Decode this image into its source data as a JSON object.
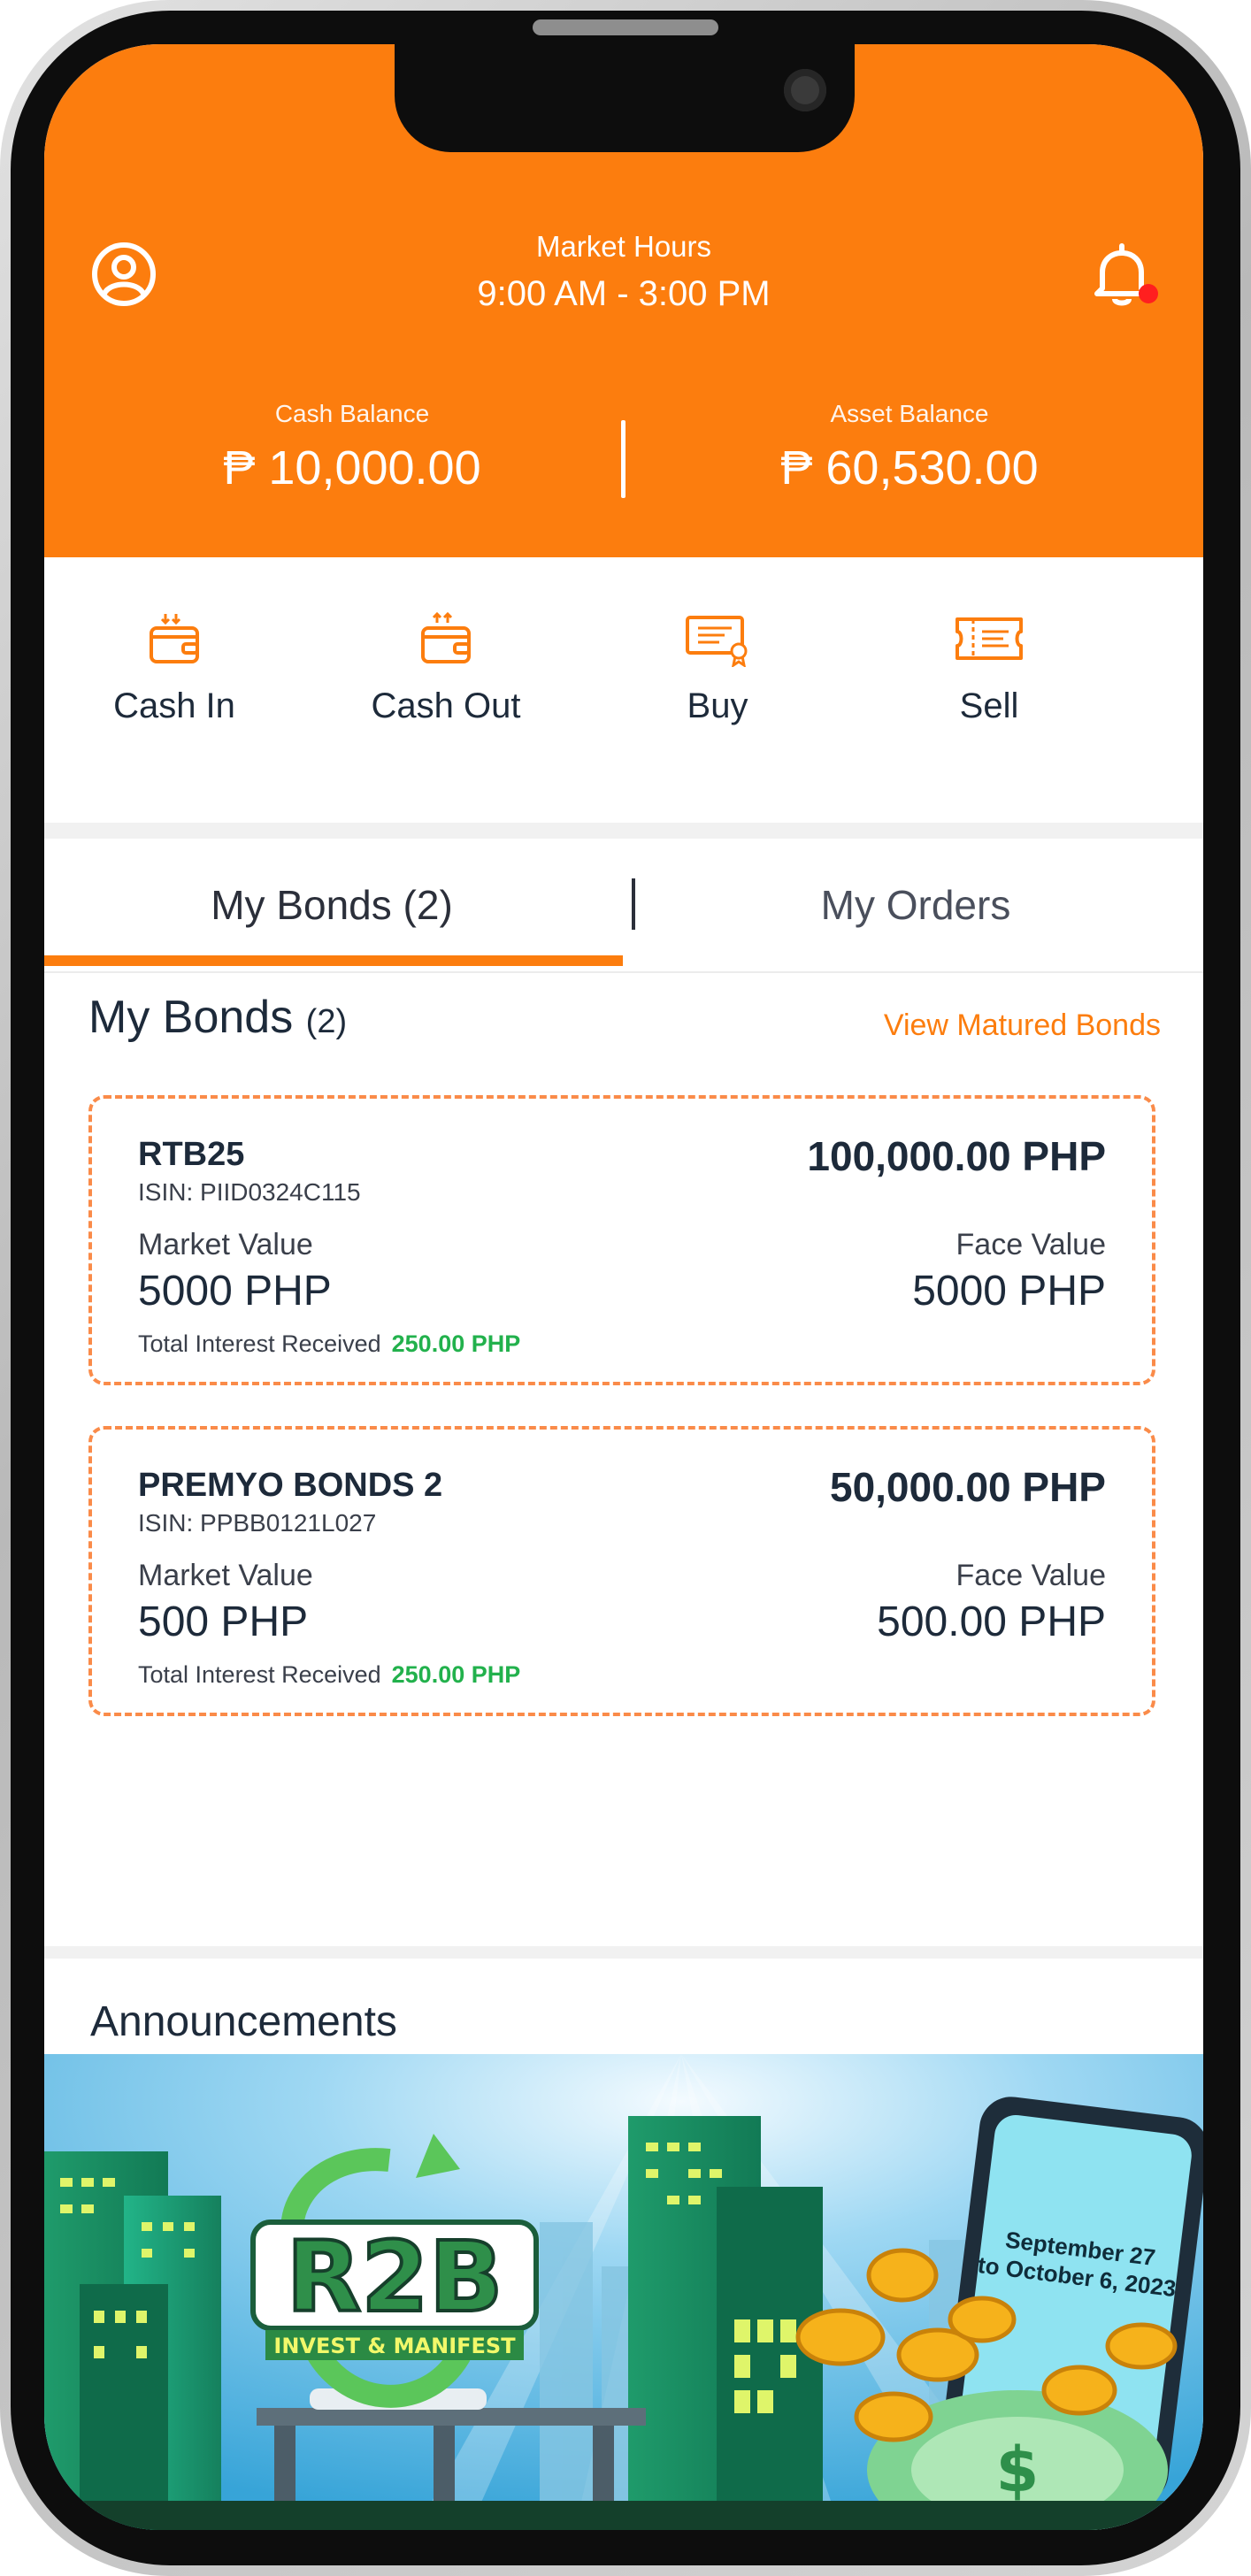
{
  "header": {
    "market_label": "Market Hours",
    "market_hours": "9:00 AM - 3:00 PM",
    "cash_label": "Cash Balance",
    "cash_value": "₱ 10,000.00",
    "asset_label": "Asset Balance",
    "asset_value": "₱ 60,530.00",
    "accent_color": "#fc7d0e",
    "notification_dot_color": "#ff1f1f"
  },
  "actions": [
    {
      "label": "Cash In",
      "icon": "wallet-in-icon"
    },
    {
      "label": "Cash Out",
      "icon": "wallet-out-icon"
    },
    {
      "label": "Buy",
      "icon": "certificate-icon"
    },
    {
      "label": "Sell",
      "icon": "ticket-icon"
    }
  ],
  "tabs": {
    "bonds": "My Bonds (2)",
    "orders": "My Orders",
    "active": "bonds"
  },
  "bonds_section": {
    "title": "My Bonds",
    "count": "(2)",
    "matured_link": "View Matured Bonds"
  },
  "bonds": [
    {
      "name": "RTB25",
      "isin": "ISIN: PIID0324C115",
      "amount": "100,000.00 PHP",
      "market_value_label": "Market Value",
      "market_value": "5000 PHP",
      "face_value_label": "Face Value",
      "face_value": "5000 PHP",
      "interest_label": "Total Interest Received",
      "interest_value": "250.00 PHP"
    },
    {
      "name": "PREMYO BONDS 2",
      "isin": "ISIN: PPBB0121L027",
      "amount": "50,000.00 PHP",
      "market_value_label": "Market Value",
      "market_value": "500 PHP",
      "face_value_label": "Face Value",
      "face_value": "500.00 PHP",
      "interest_label": "Total Interest Received",
      "interest_value": "250.00 PHP"
    }
  ],
  "announcements": {
    "title": "Announcements",
    "banner": {
      "logo_text": "R2B",
      "logo_tagline": "INVEST & MANIFEST",
      "date_line1": "September 27",
      "date_line2": "to October 6, 2023"
    }
  }
}
